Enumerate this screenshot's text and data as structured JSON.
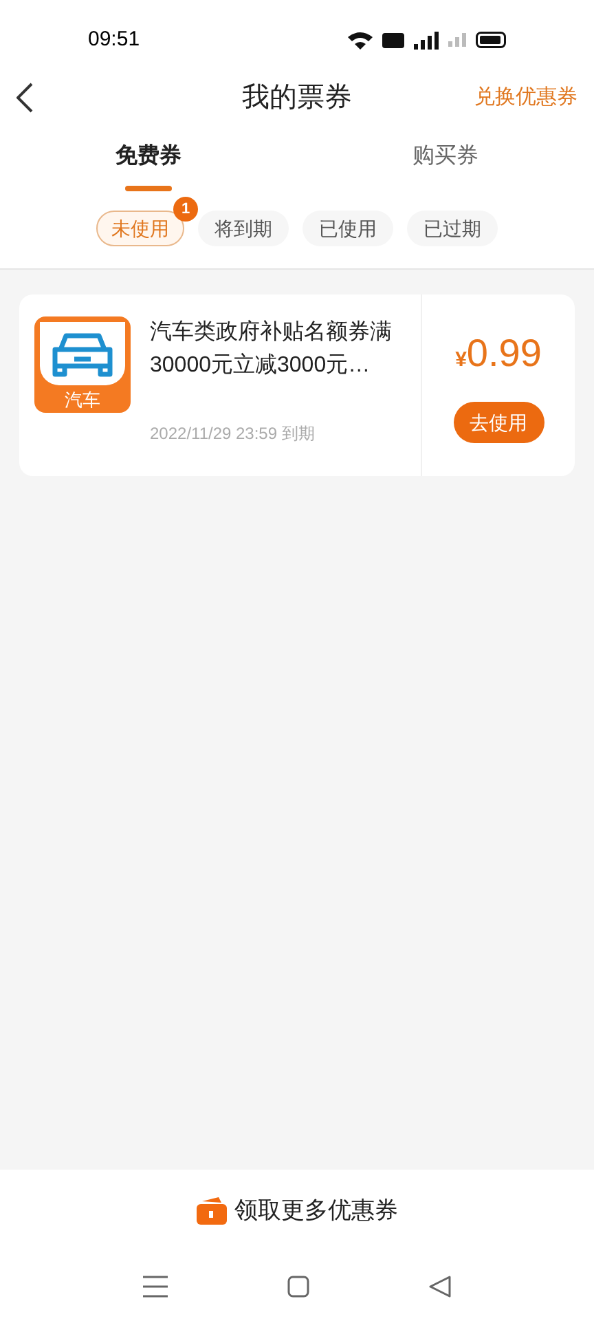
{
  "status_bar": {
    "time": "09:51"
  },
  "header": {
    "title": "我的票券",
    "action": "兑换优惠券"
  },
  "tabs": [
    {
      "label": "免费券",
      "selected": true
    },
    {
      "label": "购买券",
      "selected": false
    }
  ],
  "filters": [
    {
      "label": "未使用",
      "selected": true,
      "badge": "1"
    },
    {
      "label": "将到期",
      "selected": false
    },
    {
      "label": "已使用",
      "selected": false
    },
    {
      "label": "已过期",
      "selected": false
    }
  ],
  "coupons": [
    {
      "icon_label": "汽车",
      "title": "汽车类政府补贴名额券满30000元立减3000元…",
      "expiry": "2022/11/29 23:59 到期",
      "currency": "¥",
      "price": "0.99",
      "button": "去使用"
    }
  ],
  "bottom_action": {
    "label": "领取更多优惠券"
  }
}
